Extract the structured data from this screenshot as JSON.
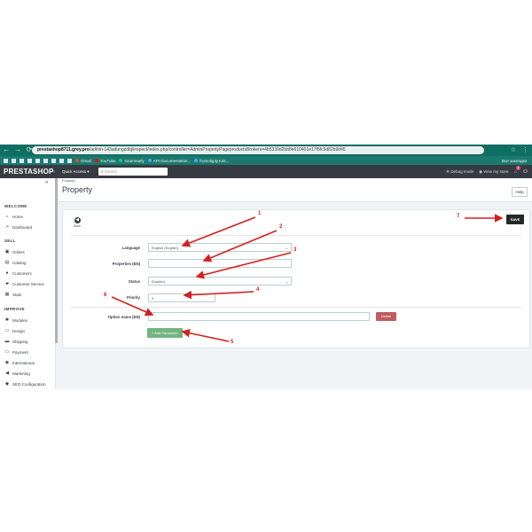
{
  "browser": {
    "nav": [
      "←",
      "→",
      "⟳"
    ],
    "url_host": "prestashop8711.grey.pro",
    "url_path": "/admin-143adungzdbj/inspect/index.php/controller=AdminPropertyPageproductsBrokers=4b5339d2bb8e610401e17f5fc5d82b9d45",
    "right_icons": [
      "☆",
      "⋮"
    ],
    "profile": "Все закладки"
  },
  "bookmarks": [
    {
      "label": "Gmail",
      "color": "#ea4335"
    },
    {
      "label": "YouTube",
      "color": "#ff0000"
    },
    {
      "label": "Grammarly",
      "color": "#15c39a"
    },
    {
      "label": "API Documentation...",
      "color": "#4aa3ff"
    },
    {
      "label": "fromobjply.ru/e...",
      "color": "#4aa3ff"
    }
  ],
  "header": {
    "logo": "PRESTASHOP",
    "version": "8.1.5",
    "quick_access": "Quick Access ▾",
    "search_placeholder": "Search",
    "debug_mode": "Debug mode",
    "view_store": "View my store",
    "notifications_count": "1"
  },
  "sidebar": {
    "collapse": "«",
    "sections": [
      {
        "title": "WELCOME",
        "items": [
          {
            "label": "Home",
            "icon": "home-icon",
            "glyph": "⌂"
          },
          {
            "label": "Dashboard",
            "icon": "trending-icon",
            "glyph": "↗"
          }
        ]
      },
      {
        "title": "SELL",
        "items": [
          {
            "label": "Orders",
            "icon": "cart-icon",
            "glyph": "▣"
          },
          {
            "label": "Catalog",
            "icon": "store-icon",
            "glyph": "▤"
          },
          {
            "label": "Customers",
            "icon": "account-icon",
            "glyph": "●"
          },
          {
            "label": "Customer Service",
            "icon": "chat-icon",
            "glyph": "▰"
          },
          {
            "label": "Stats",
            "icon": "chart-icon",
            "glyph": "▦"
          }
        ]
      },
      {
        "title": "IMPROVE",
        "items": [
          {
            "label": "Modules",
            "icon": "puzzle-icon",
            "glyph": "✱"
          },
          {
            "label": "Design",
            "icon": "desktop-icon",
            "glyph": "▭"
          },
          {
            "label": "Shipping",
            "icon": "truck-icon",
            "glyph": "▬"
          },
          {
            "label": "Payment",
            "icon": "payment-icon",
            "glyph": "▭"
          },
          {
            "label": "International",
            "icon": "globe-icon",
            "glyph": "◉"
          },
          {
            "label": "Marketing",
            "icon": "megaphone-icon",
            "glyph": "◀"
          },
          {
            "label": "SEO Configuration",
            "icon": "seo-icon",
            "glyph": "◆"
          }
        ]
      }
    ]
  },
  "page": {
    "breadcrumb": "Property",
    "title": "Property",
    "help": "Help"
  },
  "form": {
    "back_label": "Back",
    "save_label": "SAVE",
    "language_label": "Language",
    "language_value": "English (English)",
    "properties_label": "Properties (EN)",
    "properties_value": "",
    "status_label": "Status",
    "status_value": "Enabled",
    "priority_label": "Priority",
    "priority_value": "0",
    "option_label": "Option name (EN)",
    "option_value": "",
    "delete_label": "Delete",
    "add_parameter_label": "+ Add Parameter"
  },
  "annotations": [
    "1",
    "2",
    "3",
    "4",
    "5",
    "6",
    "7"
  ],
  "colors": {
    "browser_bar": "#0f6e62",
    "ps_header": "#363a41",
    "save_button": "#25272b",
    "delete_button": "#c05c5c",
    "add_button": "#70b580",
    "annotation": "#d32020"
  }
}
